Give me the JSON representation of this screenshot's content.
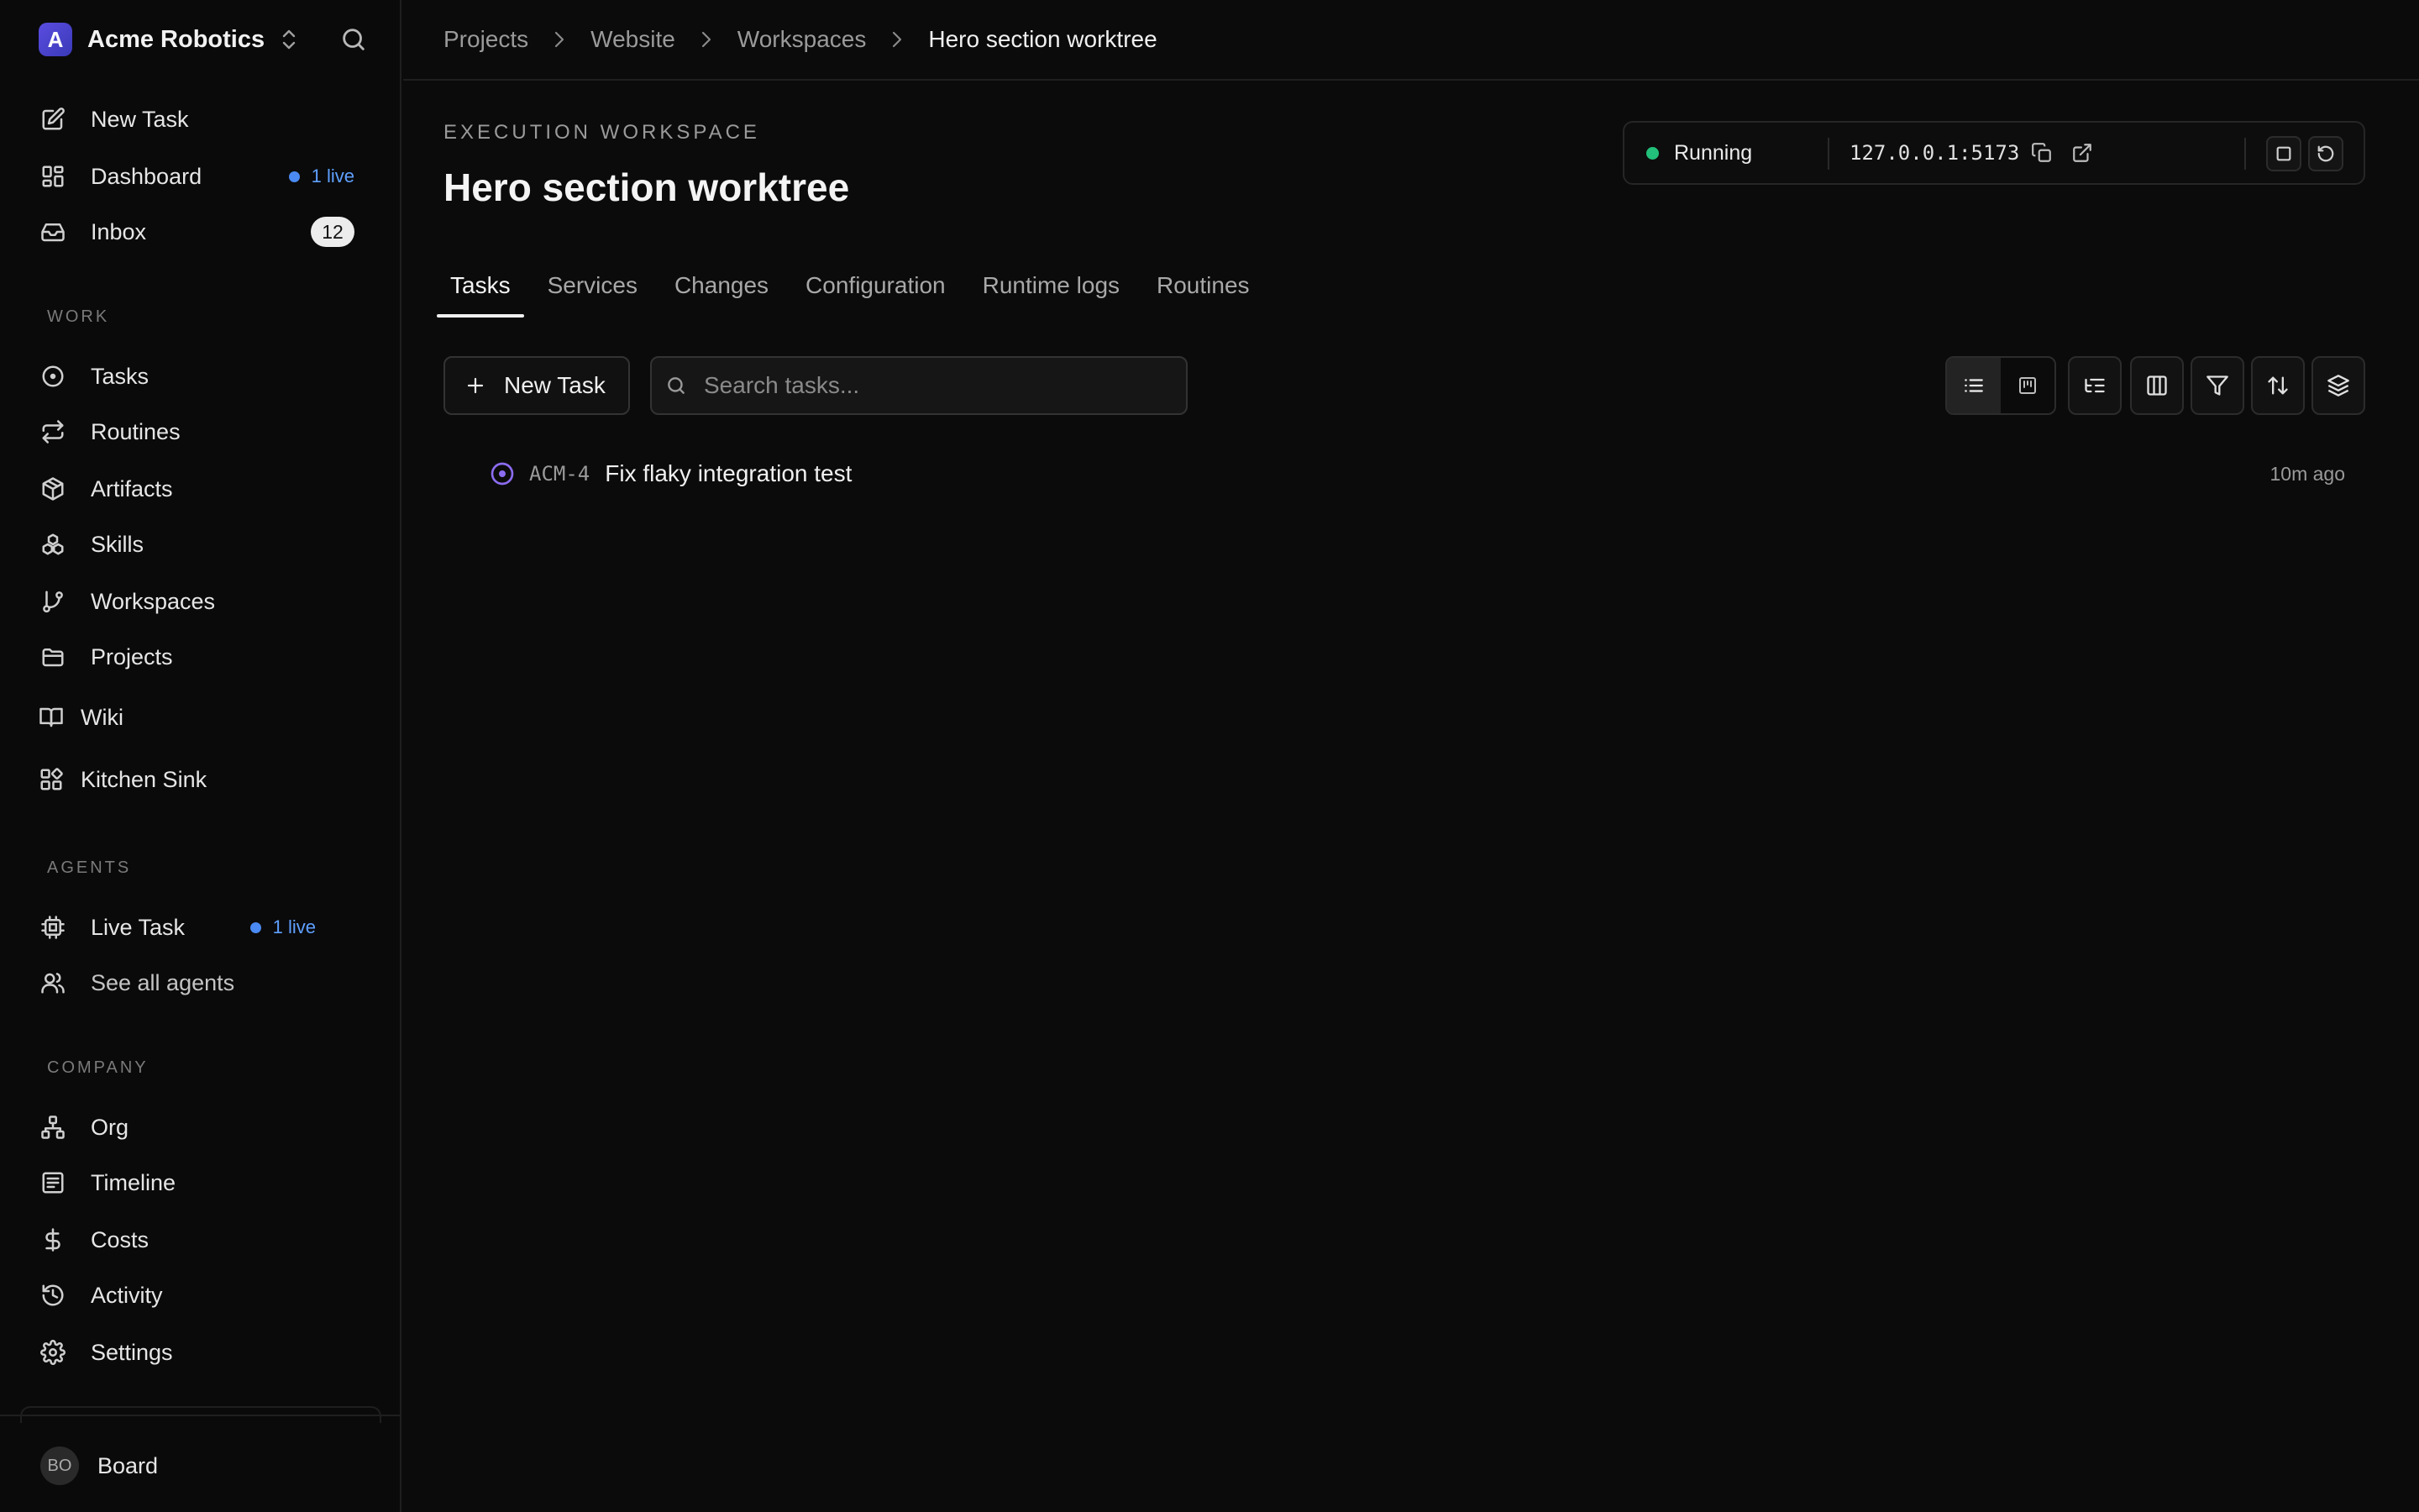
{
  "sidebar": {
    "brand": {
      "logo_letter": "A",
      "name": "Acme Robotics"
    },
    "top_items": [
      {
        "label": "New Task",
        "icon": "edit-icon"
      },
      {
        "label": "Dashboard",
        "icon": "dashboard-icon",
        "live": "1 live"
      },
      {
        "label": "Inbox",
        "icon": "inbox-icon",
        "badge": "12"
      }
    ],
    "sections": {
      "work": "WORK",
      "agents": "AGENTS",
      "company": "COMPANY"
    },
    "work_items": [
      {
        "label": "Tasks",
        "icon": "circle-dot-icon"
      },
      {
        "label": "Routines",
        "icon": "repeat-icon"
      },
      {
        "label": "Artifacts",
        "icon": "package-icon"
      },
      {
        "label": "Skills",
        "icon": "boxes-icon"
      },
      {
        "label": "Workspaces",
        "icon": "git-branch-icon"
      },
      {
        "label": "Projects",
        "icon": "folder-icon"
      }
    ],
    "extra_items": [
      {
        "label": "Wiki",
        "icon": "book-icon"
      },
      {
        "label": "Kitchen Sink",
        "icon": "blocks-icon"
      }
    ],
    "agent_items": [
      {
        "label": "Live Task",
        "icon": "cpu-icon",
        "live": "1 live"
      },
      {
        "label": "See all agents",
        "icon": "users-icon"
      }
    ],
    "company_items": [
      {
        "label": "Org",
        "icon": "network-icon"
      },
      {
        "label": "Timeline",
        "icon": "list-icon"
      },
      {
        "label": "Costs",
        "icon": "dollar-icon"
      },
      {
        "label": "Activity",
        "icon": "history-icon"
      },
      {
        "label": "Settings",
        "icon": "gear-icon"
      }
    ],
    "user": {
      "initials": "BO",
      "name": "Board"
    }
  },
  "breadcrumb": [
    "Projects",
    "Website",
    "Workspaces",
    "Hero section worktree"
  ],
  "header": {
    "eyebrow": "EXECUTION WORKSPACE",
    "title": "Hero section worktree"
  },
  "runtime": {
    "status": "Running",
    "status_color": "#22c07a",
    "address": "127.0.0.1:5173"
  },
  "tabs": [
    "Tasks",
    "Services",
    "Changes",
    "Configuration",
    "Runtime logs",
    "Routines"
  ],
  "toolbar": {
    "new_task_label": "New Task",
    "search_placeholder": "Search tasks..."
  },
  "tasks": [
    {
      "id": "ACM-4",
      "title": "Fix flaky integration test",
      "time": "10m ago",
      "status_color": "#8b6cf0"
    }
  ],
  "colors": {
    "accent_live": "#4a8af2",
    "background": "#0b0b0b"
  }
}
